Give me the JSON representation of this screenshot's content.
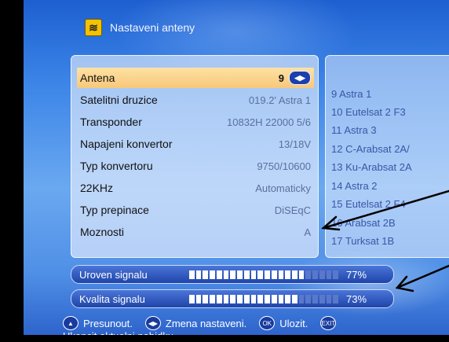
{
  "header": {
    "title": "Nastaveni anteny",
    "icon": "antenna-settings-icon"
  },
  "settings": [
    {
      "label": "Antena",
      "value": "9",
      "selected": true
    },
    {
      "label": "Satelitni druzice",
      "value": "019.2' Astra 1"
    },
    {
      "label": "Transponder",
      "value": "10832H 22000 5/6"
    },
    {
      "label": "Napajeni konvertor",
      "value": "13/18V"
    },
    {
      "label": "Typ konvertoru",
      "value": "9750/10600"
    },
    {
      "label": "22KHz",
      "value": "Automaticky"
    },
    {
      "label": "Typ prepinace",
      "value": "DiSEqC"
    },
    {
      "label": "Moznosti",
      "value": "A"
    }
  ],
  "satellites": [
    "9 Astra 1",
    "10 Eutelsat 2 F3",
    "11 Astra 3",
    "12 C-Arabsat 2A/",
    "13 Ku-Arabsat 2A",
    "14 Astra 2",
    "15 Eutelsat 2 F4",
    "16 Arabsat 2B",
    "17 Turksat 1B"
  ],
  "signal": {
    "level": {
      "label": "Uroven signalu",
      "value": "77%",
      "fraction": 0.77
    },
    "quality": {
      "label": "Kvalita signalu",
      "value": "73%",
      "fraction": 0.73
    }
  },
  "footer": {
    "move": "Presunout.",
    "change": "Zmena nastaveni.",
    "save": "Ulozit.",
    "exit_hint": "Ukoncit aktualni nabidku",
    "btn_ok": "OK",
    "btn_exit": "EXIT"
  },
  "colors": {
    "selected_row": "#f8c87a",
    "background": "#3d86e8"
  }
}
